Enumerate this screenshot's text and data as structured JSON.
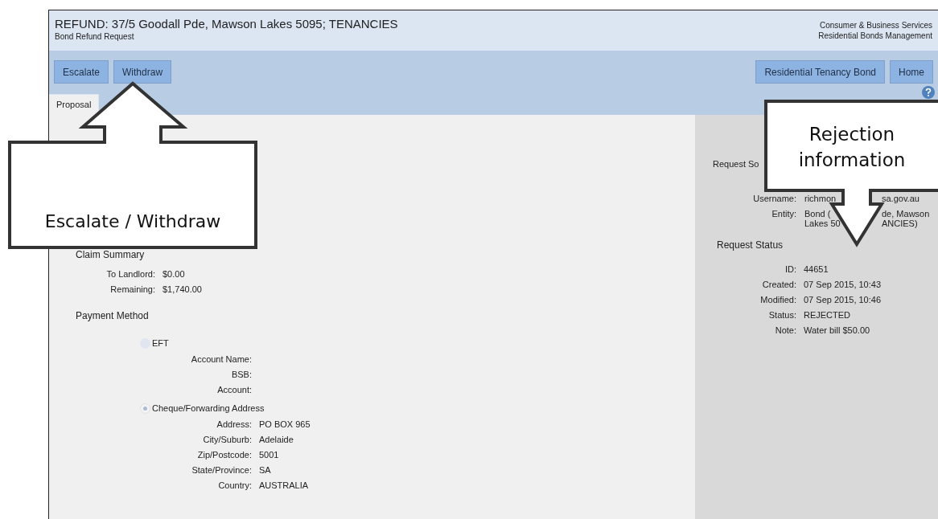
{
  "header": {
    "title": "REFUND: 37/5 Goodall Pde, Mawson Lakes 5095; TENANCIES",
    "subtitle": "Bond Refund Request",
    "org": [
      "Consumer & Business Services",
      "Residential Bonds Management"
    ]
  },
  "toolbar": {
    "left_buttons": [
      "Escalate",
      "Withdraw"
    ],
    "right_buttons": [
      "Residential Tenancy Bond",
      "Home"
    ]
  },
  "tabs": [
    {
      "label": "Proposal",
      "selected": true
    }
  ],
  "claim_summary": {
    "heading": "Claim Summary",
    "rows": [
      {
        "label": "To Landlord:",
        "value": "$0.00"
      },
      {
        "label": "Remaining:",
        "value": "$1,740.00"
      }
    ]
  },
  "payment_method": {
    "heading": "Payment Method",
    "options": [
      {
        "label": "EFT",
        "selected": false,
        "fields": [
          {
            "label": "Account Name:"
          },
          {
            "label": "BSB:"
          },
          {
            "label": "Account:"
          }
        ]
      },
      {
        "label": "Cheque/Forwarding Address",
        "selected": true,
        "fields": [
          {
            "label": "Address:",
            "value": "PO BOX 965"
          },
          {
            "label": "City/Suburb:",
            "value": "Adelaide"
          },
          {
            "label": "Zip/Postcode:",
            "value": "5001"
          },
          {
            "label": "State/Province:",
            "value": "SA"
          },
          {
            "label": "Country:",
            "value": "AUSTRALIA"
          }
        ]
      }
    ]
  },
  "request_source": {
    "heading": "Request So",
    "rows": [
      {
        "label": "Username:",
        "lines": [
          [
            "richmon",
            "sa.gov.au"
          ]
        ]
      },
      {
        "label": "Entity:",
        "lines": [
          [
            "Bond (",
            "de, Mawson"
          ],
          [
            "Lakes 50",
            "ANCIES)"
          ]
        ]
      }
    ]
  },
  "request_status": {
    "heading": "Request Status",
    "rows": [
      {
        "label": "ID:",
        "value": "44651"
      },
      {
        "label": "Created:",
        "value": "07 Sep 2015, 10:43"
      },
      {
        "label": "Modified:",
        "value": "07 Sep 2015, 10:46"
      },
      {
        "label": "Status:",
        "value": "REJECTED"
      },
      {
        "label": "Note:",
        "value": "Water bill $50.00"
      }
    ]
  },
  "callouts": [
    {
      "kind": "up",
      "text": "Escalate / Withdraw"
    },
    {
      "kind": "down",
      "text": "Rejection information"
    }
  ]
}
